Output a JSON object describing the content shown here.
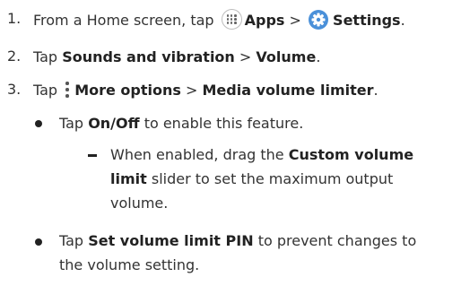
{
  "steps": [
    {
      "num": "1.",
      "lead": "From a Home screen, tap",
      "apps": "Apps",
      "sep": ">",
      "settings": "Settings",
      "end": "."
    },
    {
      "num": "2.",
      "lead": "Tap",
      "sounds": "Sounds and vibration",
      "sep": ">",
      "volume": "Volume",
      "end": "."
    },
    {
      "num": "3.",
      "lead": "Tap",
      "more": "More options",
      "sep": ">",
      "limiter": "Media volume limiter",
      "end": "."
    }
  ],
  "bullets": [
    {
      "lead": "Tap",
      "key": "On/Off",
      "rest": "to enable this feature.",
      "sub": {
        "lead": "When enabled, drag the",
        "key1": "Custom volume",
        "key2": "limit",
        "rest2": "slider to set the maximum output",
        "rest3": "volume."
      }
    },
    {
      "lead": "Tap",
      "key": "Set volume limit PIN",
      "rest": "to prevent changes to",
      "rest2": "the volume setting."
    }
  ],
  "icons": {
    "apps": "apps-grid-icon",
    "settings": "settings-gear-icon",
    "more": "more-options-icon"
  },
  "colors": {
    "text": "#333333",
    "settings_icon": "#4a90d9"
  }
}
